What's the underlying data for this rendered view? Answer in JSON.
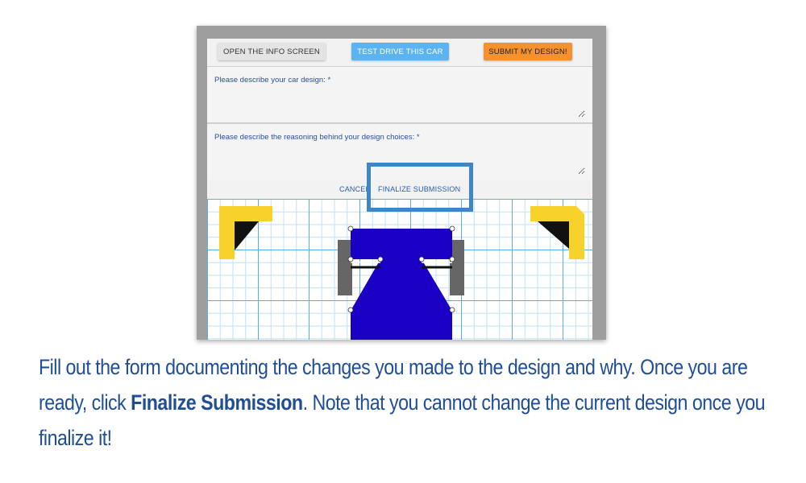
{
  "toolbar": {
    "info_label": "OPEN THE INFO SCREEN",
    "test_label": "TEST DRIVE THIS CAR",
    "submit_label": "SUBMIT MY DESIGN!"
  },
  "form": {
    "design_label": "Please describe your car design: *",
    "design_value": "",
    "reasoning_label": "Please describe the reasoning behind your design choices: *",
    "reasoning_value": "",
    "cancel_label": "CANCEL",
    "finalize_label": "FINALIZE SUBMISSION"
  },
  "instructions": {
    "part1": "Fill out the form documenting the changes you made to the design and why. Once you are ready, click ",
    "bold": "Finalize Submission",
    "part2": ". Note that you cannot change the current design once you finalize it!"
  },
  "colors": {
    "car_body": "#1a00c4",
    "wheel": "#666666",
    "bumper": "#f7d22a",
    "highlight": "#3f86c6",
    "grid": "#5aaee0"
  }
}
